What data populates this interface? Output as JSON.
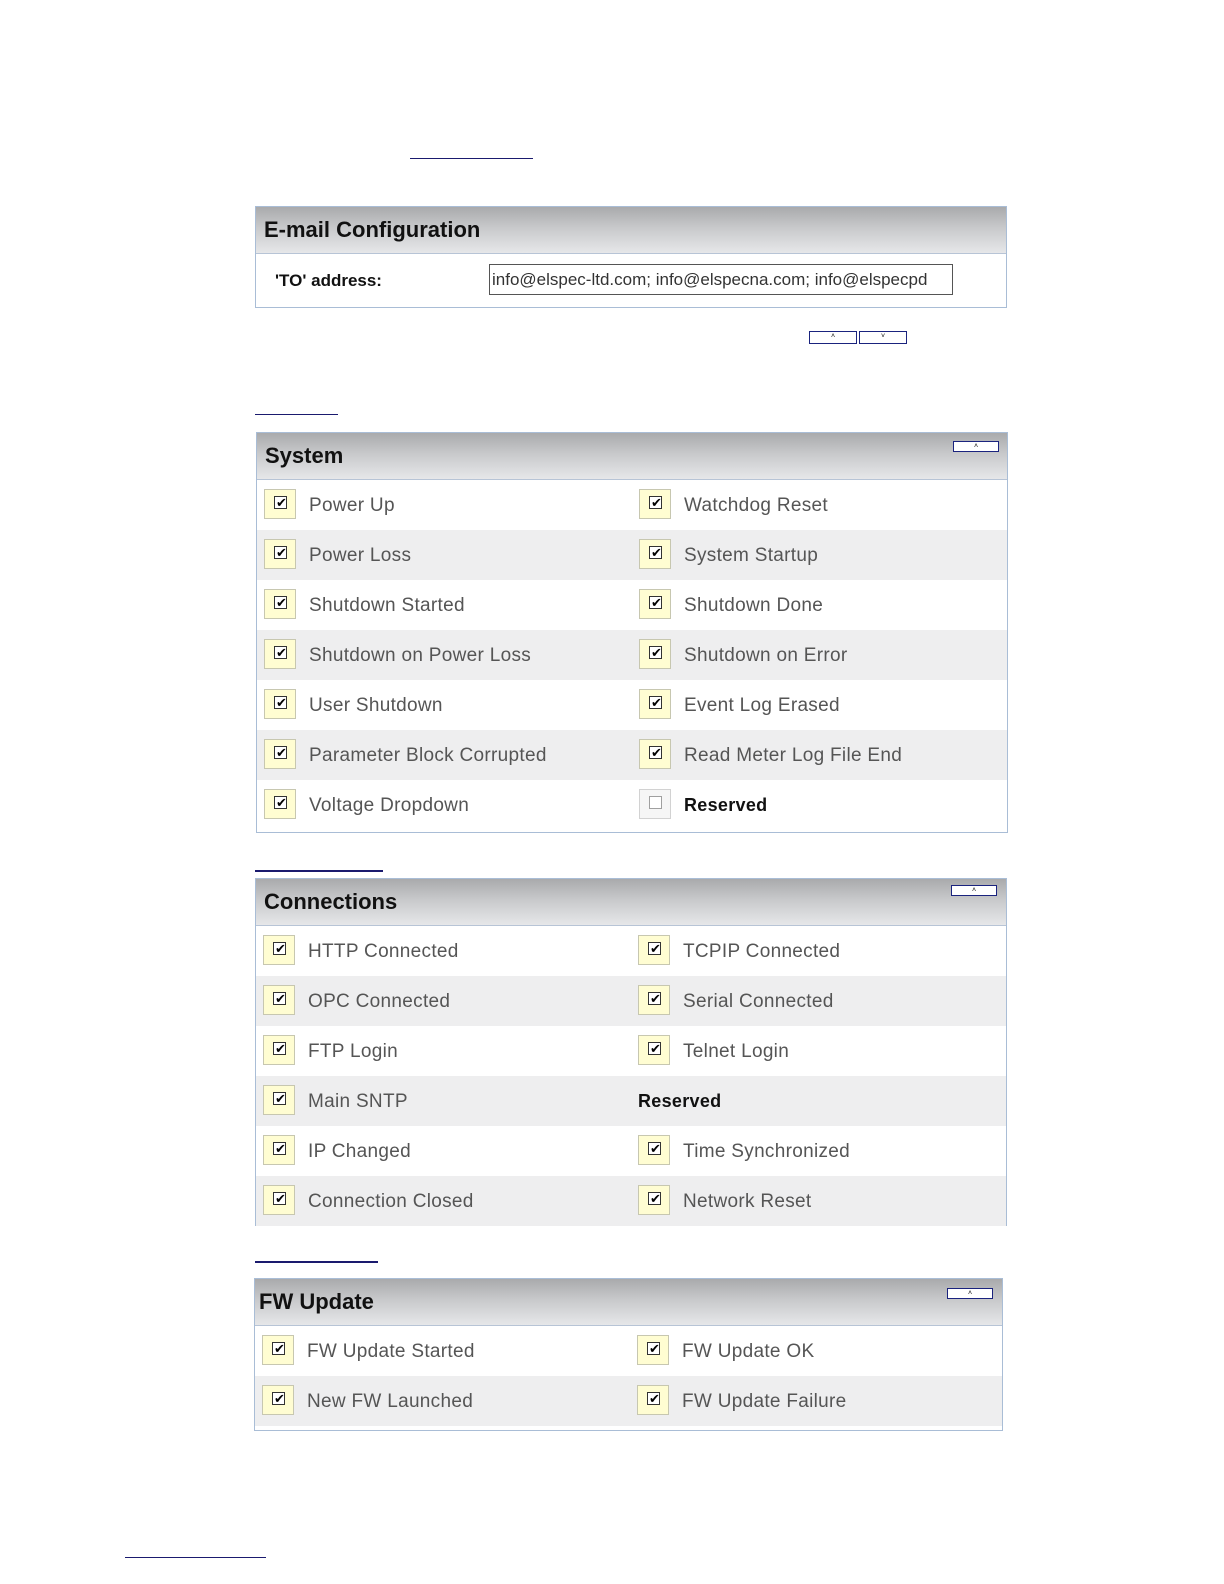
{
  "email": {
    "title": "E-mail Configuration",
    "to_label": "'TO' address:",
    "to_value": "info@elspec-ltd.com; info@elspecna.com; info@elspecpd"
  },
  "controls": {
    "up_arrow": "˄",
    "down_arrow": "˅",
    "check_mark": "✔"
  },
  "system": {
    "title": "System",
    "left": [
      "Power Up",
      "Power Loss",
      "Shutdown Started",
      "Shutdown on Power Loss",
      "User Shutdown",
      "Parameter Block Corrupted",
      "Voltage Dropdown"
    ],
    "right": [
      "Watchdog Reset",
      "System Startup",
      "Shutdown Done",
      "Shutdown on Error",
      "Event Log Erased",
      "Read Meter Log File End",
      "Reserved"
    ],
    "right_checked": [
      true,
      true,
      true,
      true,
      true,
      true,
      false
    ]
  },
  "connections": {
    "title": "Connections",
    "left": [
      "HTTP Connected",
      "OPC Connected",
      "FTP Login",
      "Main SNTP",
      "IP Changed",
      "Connection Closed"
    ],
    "right": [
      "TCPIP Connected",
      "Serial Connected",
      "Telnet Login",
      "Reserved",
      "Time Synchronized",
      "Network Reset"
    ]
  },
  "fw_update": {
    "title": "FW Update",
    "left": [
      "FW Update Started",
      "New FW Launched"
    ],
    "right": [
      "FW Update OK",
      "FW Update Failure"
    ]
  }
}
